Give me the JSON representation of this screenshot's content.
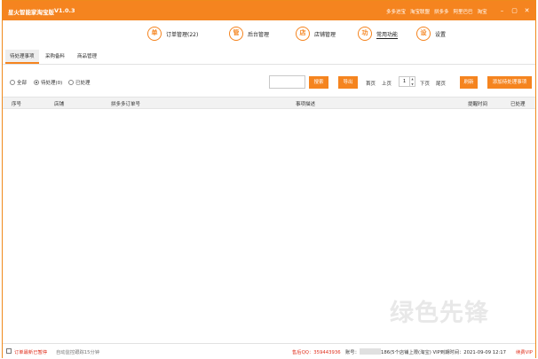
{
  "titlebar": {
    "app_name": "星火智能家淘宝版",
    "version": "V1.0.3",
    "links": [
      "多多进宝",
      "淘宝联盟",
      "拼多多",
      "阿里巴巴",
      "淘宝"
    ],
    "win_min": "–",
    "win_max": "▢",
    "win_close": "✕"
  },
  "nav": {
    "items": [
      {
        "glyph": "单",
        "label": "订单管理(22)"
      },
      {
        "glyph": "管",
        "label": "后台管理"
      },
      {
        "glyph": "店",
        "label": "店铺管理"
      },
      {
        "glyph": "功",
        "label": "常用功能"
      },
      {
        "glyph": "设",
        "label": "设置"
      }
    ]
  },
  "tabs": [
    "待处理事项",
    "采购备料",
    "商品管理"
  ],
  "filter": {
    "radios": [
      "全部",
      "待处理(0)",
      "已处理"
    ],
    "search_value": "",
    "search_button": "搜索",
    "export_button": "导出",
    "first_page": "首页",
    "prev_page": "上页",
    "page_number": "1",
    "next_page": "下页",
    "last_page": "尾页",
    "refresh_button": "刷新",
    "add_button": "添加待处理事项"
  },
  "table": {
    "columns": [
      "序号",
      "店铺",
      "拼多多订单号",
      "事项描述",
      "提醒时间",
      "已处理"
    ]
  },
  "watermark": "绿色先锋",
  "statusbar": {
    "refresh_label": "订单最新已暂停",
    "auto_text": "自动监控跟踪15分钟",
    "qq_text": "售后QQ：359443936",
    "account_prefix": "账号：",
    "account_suffix": "186(5个店铺上限(淘宝) VIP到期时间：2021-09-09 12:17",
    "renew": "续费VIP"
  },
  "colors": {
    "accent": "#f5841f",
    "alert": "#e0301e"
  }
}
